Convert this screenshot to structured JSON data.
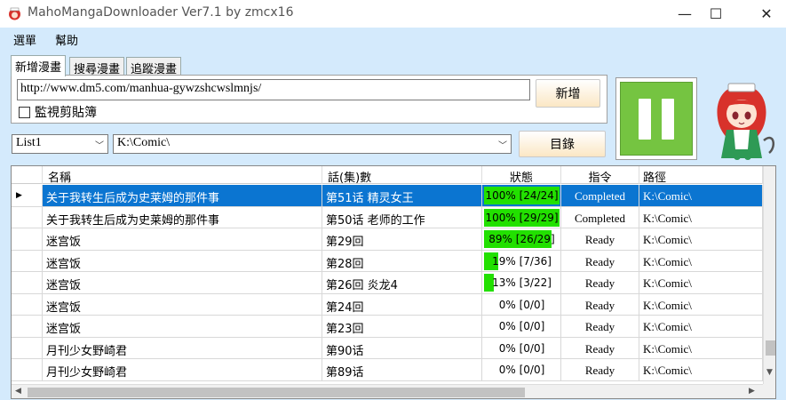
{
  "window": {
    "title": "MahoMangaDownloader Ver7.1 by zmcx16",
    "minimize_glyph": "—",
    "maximize_glyph": "☐",
    "close_glyph": "✕"
  },
  "menu": {
    "select": "選單",
    "help": "幫助"
  },
  "tabs": {
    "add": "新增漫畫",
    "search": "搜尋漫畫",
    "track": "追蹤漫畫"
  },
  "add_panel": {
    "url_value": "http://www.dm5.com/manhua-gywzshcwslmnjs/",
    "add_button": "新增",
    "monitor_clipboard": "監視剪貼簿"
  },
  "toolbar": {
    "list_value": "List1",
    "path_value": "K:\\Comic\\",
    "dir_button": "目錄",
    "dropdown_glyph": "﹀",
    "pause_icon": "pause-icon"
  },
  "table": {
    "headers": {
      "name": "名稱",
      "episode": "話(集)數",
      "status": "狀態",
      "command": "指令",
      "path": "路徑"
    },
    "selected_marker": "▶",
    "rows": [
      {
        "name": "关于我转生后成为史莱姆的那件事",
        "episode": "第51话 精灵女王",
        "status": "100% [24/24]",
        "progress": 1.0,
        "command": "Completed",
        "path": "K:\\Comic\\",
        "selected": true
      },
      {
        "name": "关于我转生后成为史莱姆的那件事",
        "episode": "第50话 老师的工作",
        "status": "100% [29/29]",
        "progress": 1.0,
        "command": "Completed",
        "path": "K:\\Comic\\",
        "selected": false
      },
      {
        "name": "迷宫饭",
        "episode": "第29回",
        "status": "89% [26/29]",
        "progress": 0.89,
        "command": "Ready",
        "path": "K:\\Comic\\",
        "selected": false
      },
      {
        "name": "迷宫饭",
        "episode": "第28回",
        "status": "19% [7/36]",
        "progress": 0.19,
        "command": "Ready",
        "path": "K:\\Comic\\",
        "selected": false
      },
      {
        "name": "迷宫饭",
        "episode": "第26回 炎龙4",
        "status": "13% [3/22]",
        "progress": 0.13,
        "command": "Ready",
        "path": "K:\\Comic\\",
        "selected": false
      },
      {
        "name": "迷宫饭",
        "episode": "第24回",
        "status": "0% [0/0]",
        "progress": 0,
        "command": "Ready",
        "path": "K:\\Comic\\",
        "selected": false
      },
      {
        "name": "迷宫饭",
        "episode": "第23回",
        "status": "0% [0/0]",
        "progress": 0,
        "command": "Ready",
        "path": "K:\\Comic\\",
        "selected": false
      },
      {
        "name": "月刊少女野崎君",
        "episode": "第90话",
        "status": "0% [0/0]",
        "progress": 0,
        "command": "Ready",
        "path": "K:\\Comic\\",
        "selected": false
      },
      {
        "name": "月刊少女野崎君",
        "episode": "第89话",
        "status": "0% [0/0]",
        "progress": 0,
        "command": "Ready",
        "path": "K:\\Comic\\",
        "selected": false
      }
    ]
  },
  "colors": {
    "accent": "#0b75d1",
    "progress": "#22e000",
    "pause_green": "#75c441",
    "panel_bg": "#d4eafc"
  }
}
